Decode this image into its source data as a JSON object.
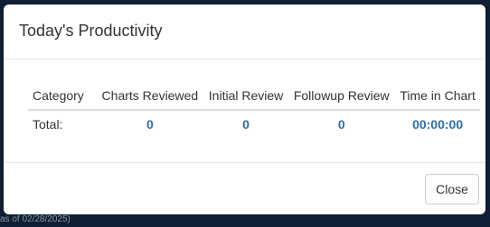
{
  "backdrop": {
    "fragment_text": "as of 02/28/2025)"
  },
  "modal": {
    "title": "Today's Productivity",
    "table": {
      "headers": [
        "Category",
        "Charts Reviewed",
        "Initial Review",
        "Followup Review",
        "Time in Chart"
      ],
      "rows": [
        {
          "label": "Total:",
          "charts_reviewed": "0",
          "initial_review": "0",
          "followup_review": "0",
          "time_in_chart": "00:00:00"
        }
      ]
    },
    "footer": {
      "close_label": "Close"
    }
  },
  "colors": {
    "backdrop": "#0f1e33",
    "value_link": "#2a6fa8",
    "text": "#333333"
  }
}
